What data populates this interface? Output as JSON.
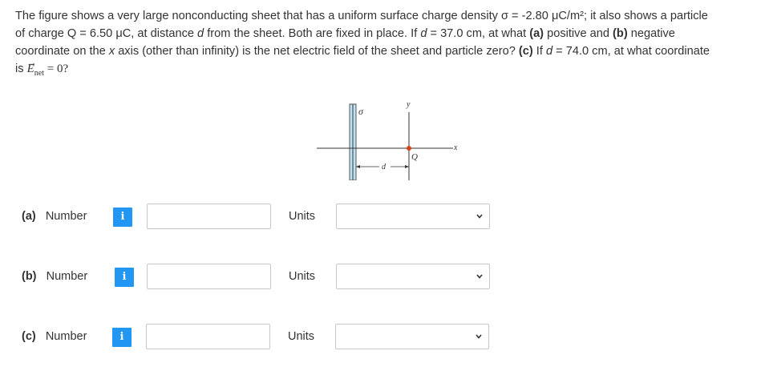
{
  "question": {
    "line1": "The figure shows a very large nonconducting sheet that has a uniform surface charge density σ = -2.80 μC/m²; it also shows a particle",
    "line2_part1": "of charge Q = 6.50 μC, at distance ",
    "line2_d": "d",
    "line2_part2": " from the sheet. Both are fixed in place. If ",
    "line2_d2": "d",
    "line2_part3": " = 37.0 cm, at what ",
    "line2_a": "(a)",
    "line2_part4": " positive and ",
    "line2_b": "(b)",
    "line2_part5": " negative",
    "line3_part1": "coordinate on the ",
    "line3_x": "x",
    "line3_part2": " axis (other than infinity) is the net electric field of the sheet and particle zero? ",
    "line3_c": "(c)",
    "line3_part3": " If ",
    "line3_d": "d",
    "line3_part4": " = 74.0 cm, at what coordinate",
    "line4_is": "is ",
    "line4_E": "E",
    "line4_arrow": "→",
    "line4_sub": "net",
    "line4_rest": " = 0?"
  },
  "figure": {
    "sigma": "σ",
    "y": "y",
    "x": "x",
    "Q": "Q",
    "d": "d"
  },
  "rows": [
    {
      "part": "(a)",
      "label": "Number",
      "info": "i",
      "units_label": "Units",
      "value": "",
      "units": ""
    },
    {
      "part": "(b)",
      "label": "Number",
      "info": "i",
      "units_label": "Units",
      "value": "",
      "units": ""
    },
    {
      "part": "(c)",
      "label": "Number",
      "info": "i",
      "units_label": "Units",
      "value": "",
      "units": ""
    }
  ],
  "colors": {
    "info_button": "#2196f3",
    "charge_dot": "#d84315",
    "sheet_fill": "#bfe3f5"
  }
}
